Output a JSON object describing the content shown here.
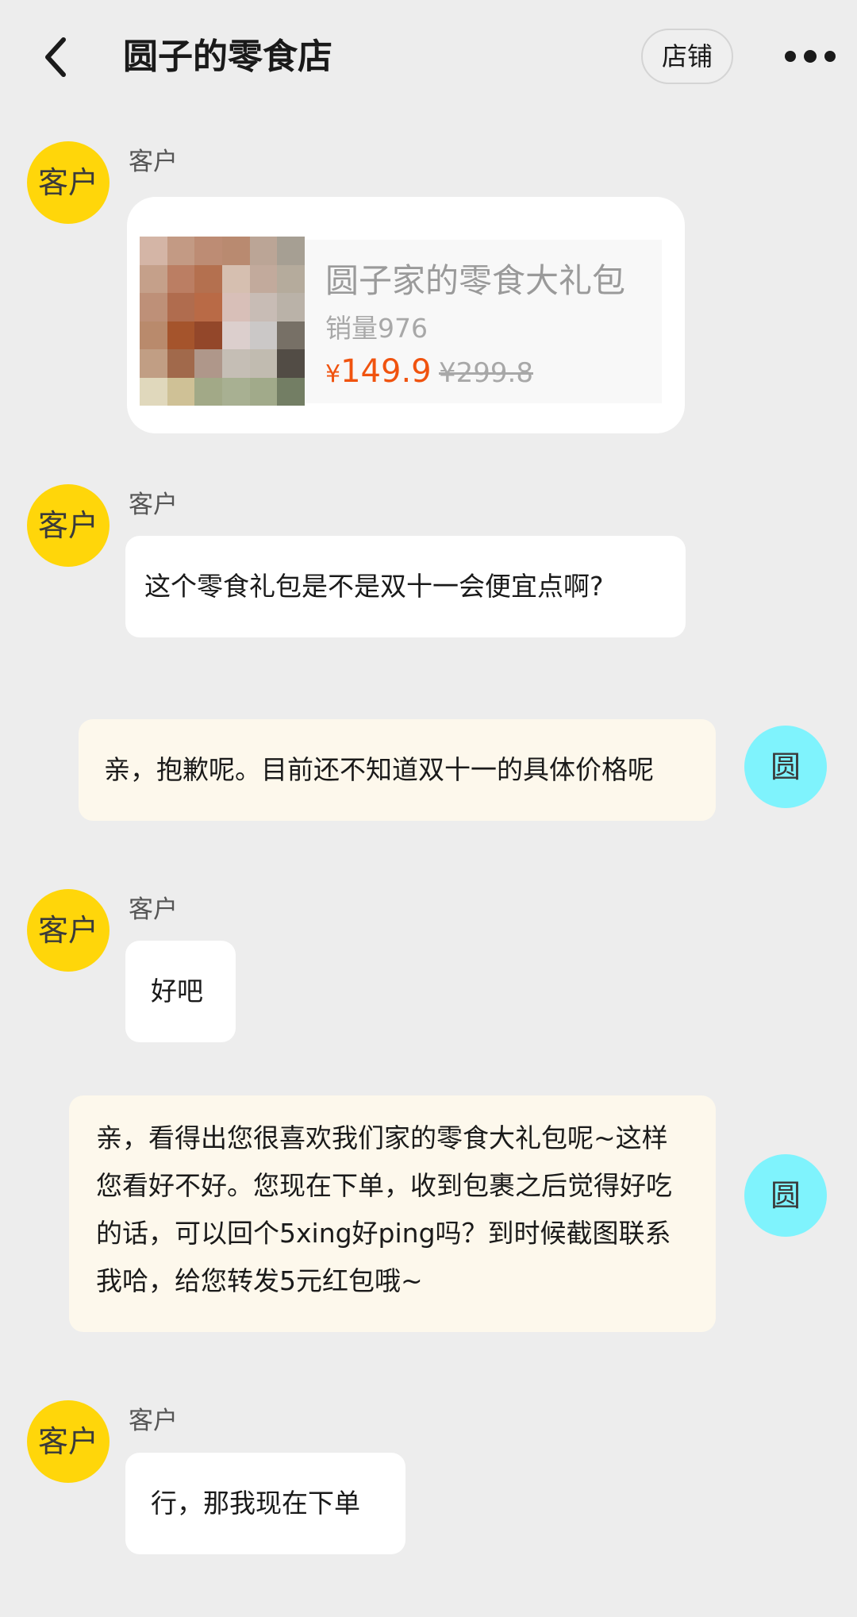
{
  "header": {
    "title": "圆子的零食店",
    "shop_label": "店铺"
  },
  "product": {
    "name": "圆子家的零食大礼包",
    "sales": "销量976",
    "currency": "¥",
    "price": "149.9",
    "original_price": "¥299.8"
  },
  "avatars": {
    "customer": "客户",
    "seller": "圆"
  },
  "messages": [
    {
      "from": "customer",
      "sender": "客户",
      "type": "product"
    },
    {
      "from": "customer",
      "sender": "客户",
      "text": "这个零食礼包是不是双十一会便宜点啊?"
    },
    {
      "from": "seller",
      "text": "亲，抱歉呢。目前还不知道双十一的具体价格呢"
    },
    {
      "from": "customer",
      "sender": "客户",
      "text": "好吧"
    },
    {
      "from": "seller",
      "text": "亲，看得出您很喜欢我们家的零食大礼包呢~这样您看好不好。您现在下单，收到包裹之后觉得好吃的话，可以回个5xing好ping吗？到时候截图联系我哈，给您转发5元红包哦~"
    },
    {
      "from": "customer",
      "sender": "客户",
      "text": "行，那我现在下单"
    }
  ],
  "colors": {
    "customer_avatar": "#ffd60a",
    "seller_avatar": "#7ff3fd",
    "seller_bubble": "#fdf8ec",
    "price": "#f0530f"
  }
}
